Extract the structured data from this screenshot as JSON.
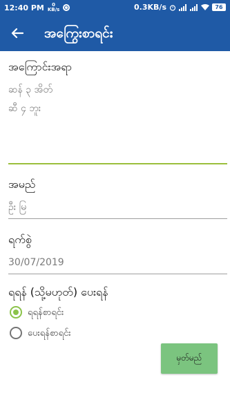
{
  "status_bar": {
    "time": "12:40 PM",
    "net_speed_small": "0",
    "net_speed_unit": "KB/s",
    "net_speed": "0.3KB/s",
    "battery": "76"
  },
  "app_bar": {
    "title": "အကြွေးစာရင်း",
    "color": "#1f5aa6"
  },
  "form": {
    "address_label": "အကြောင်းအရာ",
    "address_value_line1": "ဆန် ၃ အိတ်",
    "address_value_line2": "ဆီ ၄ ဘူး",
    "name_label": "အမည်",
    "name_value": "ဦး မြ",
    "date_label": "ရက်စွဲ",
    "date_value": "30/07/2019",
    "type_label": "ရရန် (သို့မဟုတ်) ပေးရန်",
    "options": [
      {
        "label": "ရရန်စာရင်း",
        "checked": true
      },
      {
        "label": "ပေးရန်စာရင်း",
        "checked": false
      }
    ],
    "submit_label": "မှတ်မည်",
    "accent_color": "#8bc34a"
  }
}
